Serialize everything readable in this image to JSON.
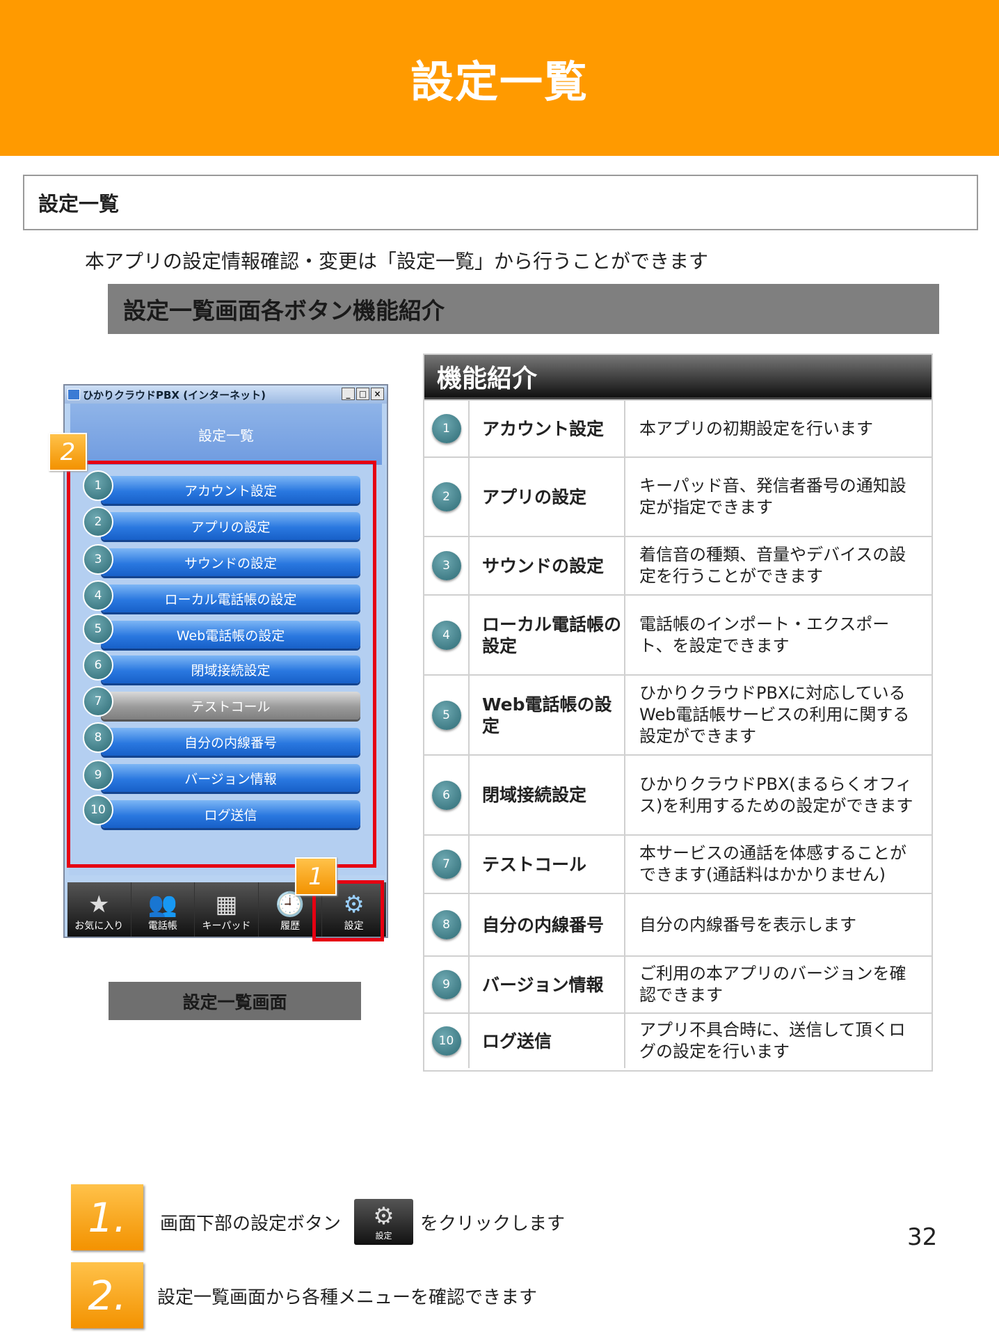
{
  "page_title": "設定一覧",
  "section_title": "設定一覧",
  "intro_text": "本アプリの設定情報確認・変更は「設定一覧」から行うことができます",
  "subheader": "設定一覧画面各ボタン機能紹介",
  "phone": {
    "window_title": "ひかりクラウドPBX (インターネット)",
    "window_buttons": [
      "_",
      "□",
      "×"
    ],
    "header": "設定一覧",
    "menu_numbers": [
      "1",
      "2",
      "3",
      "4",
      "5",
      "6",
      "7",
      "8",
      "9",
      "10"
    ],
    "menu_items": [
      "アカウント設定",
      "アプリの設定",
      "サウンドの設定",
      "ローカル電話帳の設定",
      "Web電話帳の設定",
      "閉域接続設定",
      "テストコール",
      "自分の内線番号",
      "バージョン情報",
      "ログ送信"
    ],
    "tabs": [
      {
        "label": "お気に入り",
        "icon": "star-icon",
        "glyph": "★"
      },
      {
        "label": "電話帳",
        "icon": "contacts-icon",
        "glyph": "👥"
      },
      {
        "label": "キーパッド",
        "icon": "keypad-icon",
        "glyph": "▦"
      },
      {
        "label": "履歴",
        "icon": "clock-icon",
        "glyph": "🕘"
      },
      {
        "label": "設定",
        "icon": "gear-icon",
        "glyph": "⚙"
      }
    ],
    "callout_1": "1",
    "callout_2": "2"
  },
  "screen_caption": "設定一覧画面",
  "feature_table": {
    "header": "機能紹介",
    "rows": [
      {
        "num": "1",
        "name": "アカウント設定",
        "desc": "本アプリの初期設定を行います"
      },
      {
        "num": "2",
        "name": "アプリの設定",
        "desc": "キーパッド音、発信者番号の通知設定が指定できます"
      },
      {
        "num": "3",
        "name": "サウンドの設定",
        "desc": "着信音の種類、音量やデバイスの設定を行うことができます"
      },
      {
        "num": "4",
        "name": "ローカル電話帳の設定",
        "desc": "電話帳のインポート・エクスポート、を設定できます"
      },
      {
        "num": "5",
        "name": "Web電話帳の設定",
        "desc": "ひかりクラウドPBXに対応しているWeb電話帳サービスの利用に関する設定ができます"
      },
      {
        "num": "6",
        "name": "閉域接続設定",
        "desc": "ひかりクラウドPBX(まるらくオフィス)を利用するための設定ができます"
      },
      {
        "num": "7",
        "name": "テストコール",
        "desc": "本サービスの通話を体感することができます(通話料はかかりません)"
      },
      {
        "num": "8",
        "name": "自分の内線番号",
        "desc": "自分の内線番号を表示します"
      },
      {
        "num": "9",
        "name": "バージョン情報",
        "desc": "ご利用の本アプリのバージョンを確認できます"
      },
      {
        "num": "10",
        "name": "ログ送信",
        "desc": "アプリ不具合時に、送信して頂くログの設定を行います"
      }
    ]
  },
  "steps": [
    {
      "num": "1.",
      "text_before": "画面下部の設定ボタン",
      "text_after": "をクリックします"
    },
    {
      "num": "2.",
      "text": "設定一覧画面から各種メニューを確認できます"
    }
  ],
  "settings_button": {
    "label": "設定",
    "icon": "gear-icon",
    "glyph": "⚙"
  },
  "page_number": "32",
  "colors": {
    "accent": "#ff9a00",
    "highlight": "#e60012",
    "menu_blue": "#2a78e0"
  }
}
